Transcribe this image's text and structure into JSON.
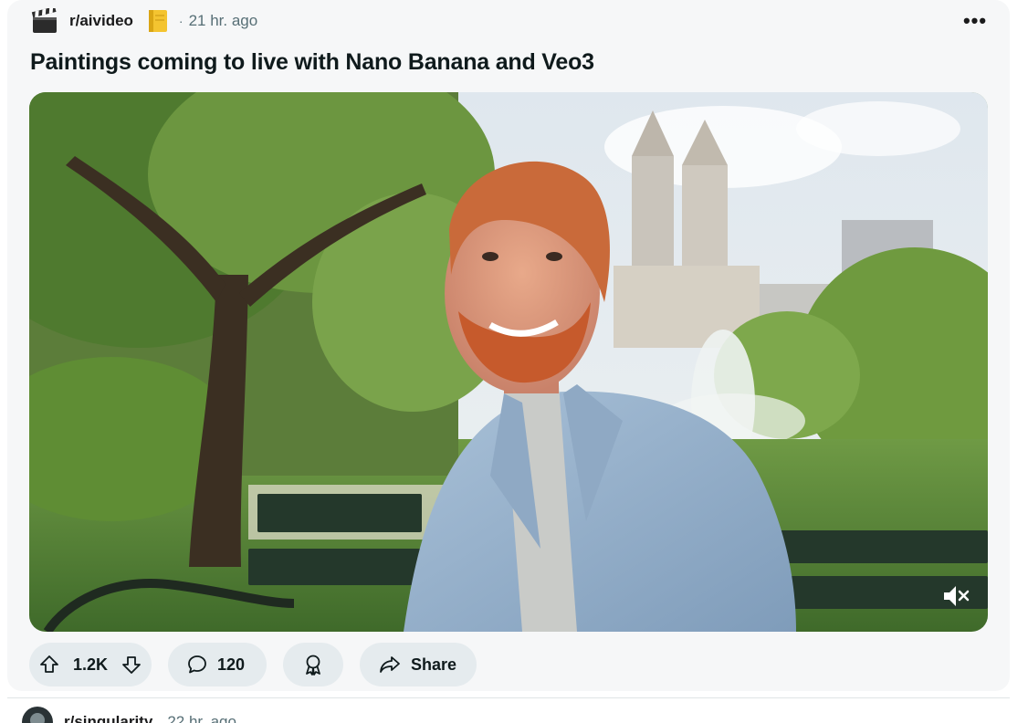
{
  "post": {
    "subreddit": "r/aivideo",
    "time_separator": "·",
    "time": "21 hr. ago",
    "title": "Paintings coming to live with Nano Banana and Veo3",
    "more_label": "•••",
    "media": {
      "type": "video",
      "muted": true
    },
    "actions": {
      "score": "1.2K",
      "comments": "120",
      "share_label": "Share"
    }
  },
  "next_post": {
    "subreddit": "r/singularity",
    "time": "22 hr. ago"
  },
  "colors": {
    "card_bg": "#f6f7f8",
    "pill_bg": "#e5ebee",
    "meta_text": "#576f76"
  },
  "icons": {
    "subreddit": "clapperboard-icon",
    "badge": "note-icon",
    "upvote": "arrow-up-icon",
    "downvote": "arrow-down-icon",
    "comment": "speech-bubble-icon",
    "award": "award-icon",
    "share": "share-arrow-icon",
    "mute": "speaker-muted-icon"
  }
}
